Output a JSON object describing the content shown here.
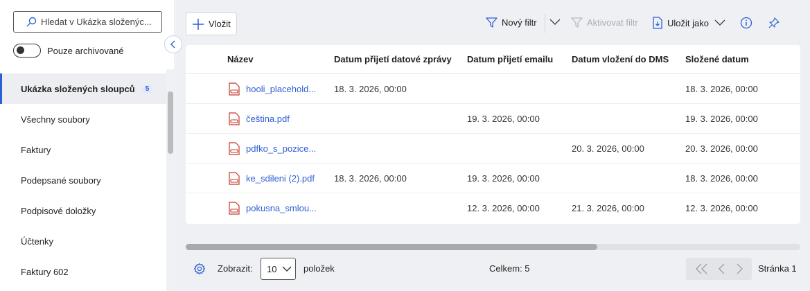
{
  "sidebar": {
    "search_placeholder": "Hledat v Ukázka složenýc...",
    "archive_toggle_label": "Pouze archivované",
    "items": [
      {
        "label": "Ukázka složených sloupců",
        "count": "5",
        "active": true
      },
      {
        "label": "Všechny soubory"
      },
      {
        "label": "Faktury"
      },
      {
        "label": "Podepsané soubory"
      },
      {
        "label": "Podpisové doložky"
      },
      {
        "label": "Účtenky"
      },
      {
        "label": "Faktury 602"
      }
    ]
  },
  "toolbar": {
    "insert_label": "Vložit",
    "new_filter_label": "Nový filtr",
    "activate_filter_label": "Aktivovat filtr",
    "save_as_label": "Uložit jako"
  },
  "table": {
    "columns": [
      "Název",
      "Datum přijetí datové zprávy",
      "Datum přijetí emailu",
      "Datum vložení do DMS",
      "Složené datum"
    ],
    "rows": [
      {
        "name": "hooli_placehold...",
        "data_msg": "18. 3. 2026, 00:00",
        "email": "",
        "dms": "",
        "composed": "18. 3. 2026, 00:00"
      },
      {
        "name": "čeština.pdf",
        "data_msg": "",
        "email": "19. 3. 2026, 00:00",
        "dms": "",
        "composed": "19. 3. 2026, 00:00"
      },
      {
        "name": "pdfko_s_pozice...",
        "data_msg": "",
        "email": "",
        "dms": "20. 3. 2026, 00:00",
        "composed": "20. 3. 2026, 00:00"
      },
      {
        "name": "ke_sdileni (2).pdf",
        "data_msg": "18. 3. 2026, 00:00",
        "email": "19. 3. 2026, 00:00",
        "dms": "",
        "composed": "18. 3. 2026, 00:00"
      },
      {
        "name": "pokusna_smlou...",
        "data_msg": "",
        "email": "12. 3. 2026, 00:00",
        "dms": "21. 3. 2026, 00:00",
        "composed": "12. 3. 2026, 00:00"
      }
    ]
  },
  "footer": {
    "show_label": "Zobrazit:",
    "page_size": "10",
    "items_label": "položek",
    "total_label": "Celkem: 5",
    "page_label": "Stránka 1"
  },
  "colors": {
    "accent": "#2f5fd6",
    "pdf_icon": "#c0392b",
    "background": "#eef0f3"
  }
}
